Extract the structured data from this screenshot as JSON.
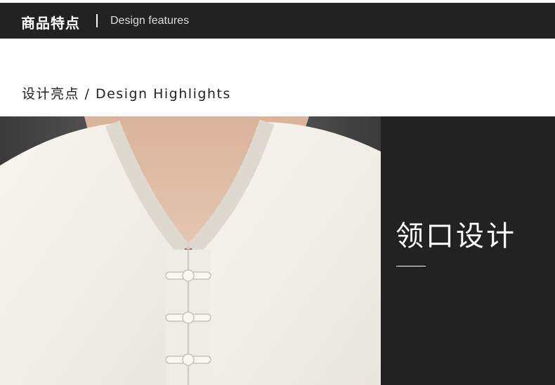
{
  "header": {
    "title_cn": "商品特点",
    "separator": "|",
    "title_en": "Design features"
  },
  "subheading": {
    "text": "设计亮点 / Design Highlights"
  },
  "feature": {
    "title": "领口设计"
  },
  "colors": {
    "header_bg": "#222222",
    "panel_bg": "#222222",
    "shirt": "#f4f2ec",
    "skin": "#e0bfa6"
  }
}
